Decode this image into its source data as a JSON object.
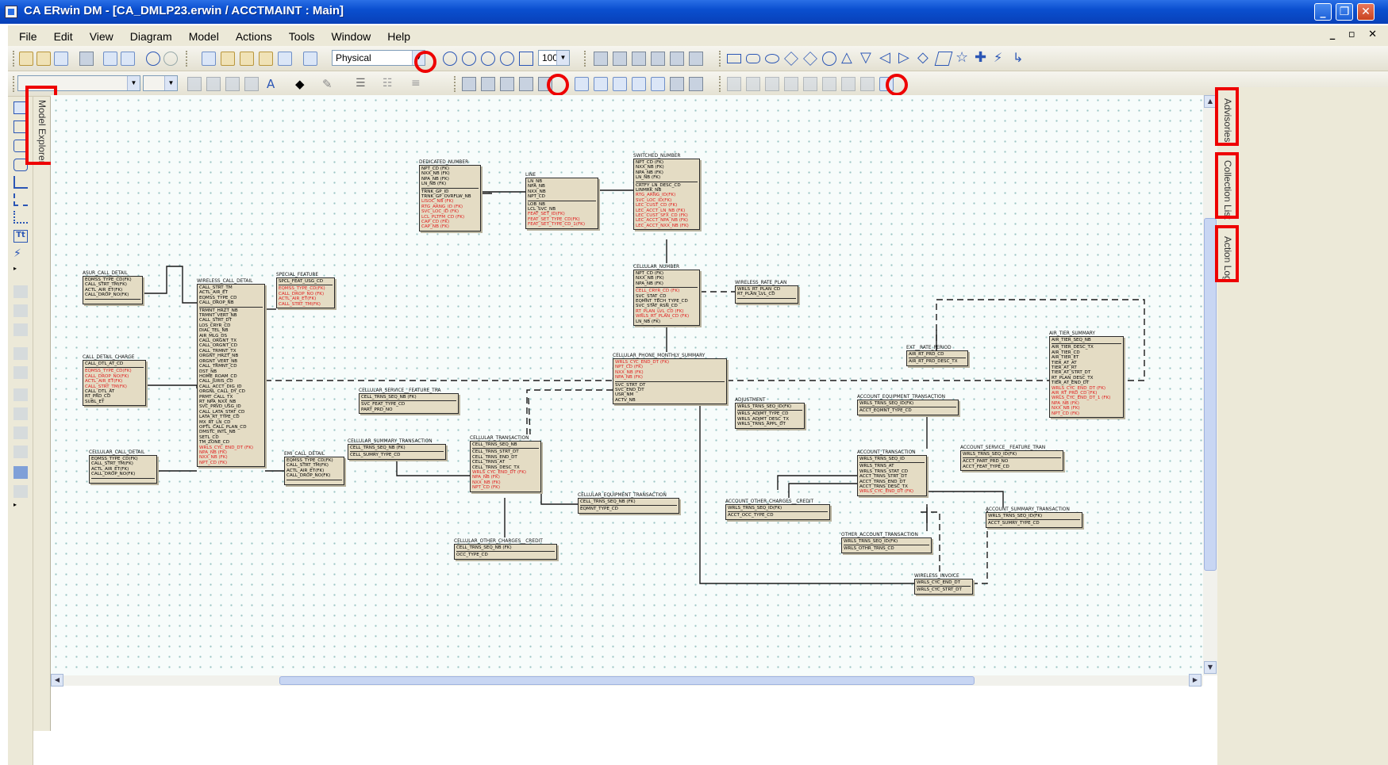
{
  "window": {
    "title": "CA ERwin DM - [CA_DMLP23.erwin / ACCTMAINT : Main]"
  },
  "menu": [
    "File",
    "Edit",
    "View",
    "Diagram",
    "Model",
    "Actions",
    "Tools",
    "Window",
    "Help"
  ],
  "mdi_controls": "_ ▫ ✕",
  "toolbar": {
    "view_mode": "Physical",
    "zoom": "100"
  },
  "panels": {
    "model_explorer": "Model Explorer",
    "advisories": "Advisories",
    "collection_list": "Collection List",
    "action_log": "Action Log"
  },
  "colors": {
    "attribute_fk": "#e02020",
    "entity_fill": "#e4dcc4",
    "highlight": "#ee0000"
  },
  "entities": [
    {
      "id": "dedicated",
      "name": "DEDICATED_NUMBER",
      "keys": [
        "NPT_CD (FK)",
        "NXX_NB (FK)",
        "NPA_NB (FK)",
        "LN_NB (FK)"
      ],
      "attrs": [
        [
          "TRNK_GP_ID",
          0
        ],
        [
          "TRNK_GP_OVRFLW_NB",
          0
        ],
        [
          "LISOC_NB (FK)",
          1
        ],
        [
          "RTG_ARNG_ID (FK)",
          1
        ],
        [
          "SVC_LOC_ID (FK)",
          1
        ],
        [
          "LCL_PLTFM_CD (FK)",
          1
        ],
        [
          "CAP_CD (FK)",
          1
        ],
        [
          "CAP_NB (FK)",
          1
        ]
      ]
    },
    {
      "id": "line",
      "name": "LINE",
      "keys": [
        "LN_NB",
        "NPA_NB",
        "NXX_NB",
        "NPT_CD"
      ],
      "attrs": [
        [
          "LOB_NB",
          0
        ],
        [
          "LCL_SVC_NB",
          0
        ],
        [
          "FEAT_SET_ID(FK)",
          1
        ],
        [
          "FEAT_SET_TYPE_CD(FK)",
          1
        ],
        [
          "FEAT_SET_TYPE_CD_1(FK)",
          1
        ]
      ]
    },
    {
      "id": "switched",
      "name": "SWITCHED_NUMBER",
      "keys": [
        "NPT_CD (FK)",
        "NXX_NB (FK)",
        "NPA_NB (FK)",
        "LN_NB (FK)"
      ],
      "attrs": [
        [
          "CRTFY_LN_DESC_CD",
          0
        ],
        [
          "LINMRK_NB",
          0
        ],
        [
          "RTG_ARNG_ID(FK)",
          1
        ],
        [
          "SVC_LOC_ID(FK)",
          1
        ],
        [
          "LEC_CUST_CD (FK)",
          1
        ],
        [
          "LEC_ACCT_LN_NB (FK)",
          1
        ],
        [
          "LEC_CUST_SFX_CD (FK)",
          1
        ],
        [
          "LEC_ACCT_NPA_NB (FK)",
          1
        ],
        [
          "LEC_ACCT_NXX_NB (FK)",
          1
        ]
      ]
    },
    {
      "id": "cellnum",
      "name": "CELLULAR_NUMBER",
      "keys": [
        "NPT_CD (FK)",
        "NXX_NB (FK)",
        "NPA_NB (FK)"
      ],
      "attrs": [
        [
          "CELL_CRYR_CD (FK)",
          1
        ],
        [
          "SVC_STAT_CD",
          0
        ],
        [
          "EQMNT_TECH_TYPE_CD",
          0
        ],
        [
          "SVC_STAT_RSN_CD",
          0
        ],
        [
          "RT_PLAN_LVL_CD (FK)",
          1
        ],
        [
          "WRLS_RT_PLAN_CD (FK)",
          1
        ],
        [
          "LN_NB (FK)",
          0
        ]
      ]
    },
    {
      "id": "wrate",
      "name": "WIRELESS_RATE_PLAN",
      "keys": [
        "WRLS_RT_PLAN_CD",
        "RT_PLAN_LVL_CD"
      ],
      "attrs": []
    },
    {
      "id": "asur",
      "name": "ASUR_CALL_DETAIL",
      "keys": [
        "EQMSS_TYPE_CD(FK)",
        "CALL_STRT_TM(FK)",
        "ACTL_AIR_ET(FK)",
        "CALL_DROP_NO(FK)"
      ],
      "attrs": []
    },
    {
      "id": "wcall",
      "name": "WIRELESS_CALL_DETAIL",
      "keys": [
        "CALL_STRT_TM",
        "ACTL_AIR_ET",
        "EQMSS_TYPE_CD",
        "CALL_DROP_NB"
      ],
      "attrs": [
        [
          "TRMNT_HRZT_NB",
          0
        ],
        [
          "TRMNT_VERT_NB",
          0
        ],
        [
          "CALL_STRT_DT",
          0
        ],
        [
          "LOS_CRYR_CD",
          0
        ],
        [
          "DIAL_TEL_NB",
          0
        ],
        [
          "AIR_MLG_DS",
          0
        ],
        [
          "CALL_ORGNT_TX",
          0
        ],
        [
          "CALL_ORGNT_CD",
          0
        ],
        [
          "CALL_TRMNT_TX",
          0
        ],
        [
          "ORGNT_HRZT_NB",
          0
        ],
        [
          "ORGNT_VERT_NB",
          0
        ],
        [
          "CALL_TRMNT_CD",
          0
        ],
        [
          "DST_NB",
          0
        ],
        [
          "HOME_ROAM_CD",
          0
        ],
        [
          "CALL_JURIS_CD",
          0
        ],
        [
          "CALL_ACCT_DIG_ID",
          0
        ],
        [
          "ORGNL_CALL_DY_CD",
          0
        ],
        [
          "PRMT_CALL_TX",
          0
        ],
        [
          "RT_NPA_NXX_NB",
          0
        ],
        [
          "SVC_PRVD_USG_ID",
          0
        ],
        [
          "CALL_LATA_STAT_CD",
          0
        ],
        [
          "LATA_RT_TYPE_CD",
          0
        ],
        [
          "MX_RT_LN_CD",
          0
        ],
        [
          "OPTL_CALL_PLAN_CD",
          0
        ],
        [
          "DMSTC_INTL_NB",
          0
        ],
        [
          "SETL_CD",
          0
        ],
        [
          "TM_ZONE_CD",
          0
        ],
        [
          "WRLS_CYC_END_DT (FK)",
          1
        ],
        [
          "NPA_NB (FK)",
          1
        ],
        [
          "NXX_NB (FK)",
          1
        ],
        [
          "NPT_CD (FK)",
          1
        ]
      ]
    },
    {
      "id": "special",
      "name": "SPECIAL_FEATURE",
      "keys": [
        "SPCL_FEAT_USG_CD"
      ],
      "attrs": [
        [
          "EQMSS_TYPE_CD(FK)",
          1
        ],
        [
          "CALL_DROP_NO (FK)",
          1
        ],
        [
          "ACTL_AIR_ET(FK)",
          1
        ],
        [
          "CALL_STRT_TM(FK)",
          1
        ]
      ]
    },
    {
      "id": "cdcharge",
      "name": "CALL_DETAIL_CHARGE",
      "keys": [
        "CALL_DTL_AT_CD"
      ],
      "attrs": [
        [
          "EQMSS_TYPE_CD(FK)",
          1
        ],
        [
          "CALL_DROP_NO(FK)",
          1
        ],
        [
          "ACTL_AIR_ET(FK)",
          1
        ],
        [
          "CALL_STRT_TM(FK)",
          1
        ],
        [
          "CALL_DTL_AT",
          0
        ],
        [
          "RT_PRD_CD",
          0
        ],
        [
          "SUBL_ET",
          0
        ]
      ]
    },
    {
      "id": "cellcall",
      "name": "CELLULAR_CALL_DETAIL",
      "keys": [
        "EQMSS_TYPE_CD(FK)",
        "CALL_STRT_TM(FK)",
        "ACTL_AIR_ET(FK)",
        "CALL_DROP_NO(FK)"
      ],
      "attrs": []
    },
    {
      "id": "emcall",
      "name": "EMI_CALL_DETAIL",
      "keys": [
        "EQMSS_TYPE_CD(FK)",
        "CALL_STRT_TM(FK)",
        "ACTL_AIR_ET(FK)",
        "CALL_DROP_NO(FK)"
      ],
      "attrs": []
    },
    {
      "id": "monthly",
      "name": "CELLULAR_PHONE_MONTHLY_SUMMARY",
      "keys": [
        "WRLS_CYC_END_DT (FK)",
        "NPT_CD (FK)",
        "NXX_NB (FK)",
        "NPA_NB (FK)"
      ],
      "attrs": [
        [
          "SVC_STRT_DT",
          0
        ],
        [
          "SVC_END_DT",
          0
        ],
        [
          "USR_NM",
          0
        ],
        [
          "ACTV_NB",
          0
        ]
      ]
    },
    {
      "id": "cellsvc",
      "name": "CELLULAR_SERVICE__FEATURE_TRA",
      "keys": [
        "CELL_TRNS_SEQ_NB (FK)"
      ],
      "attrs": [
        [
          "SVC_FEAT_TYPE_CD",
          0
        ],
        [
          "PART_PRD_NO",
          0
        ]
      ]
    },
    {
      "id": "cellsum",
      "name": "CELLULAR_SUMMARY_TRANSACTION",
      "keys": [
        "CELL_TRNS_SEQ_NB (FK)"
      ],
      "attrs": [
        [
          "CELL_SUMRY_TYPE_CD",
          0
        ]
      ]
    },
    {
      "id": "celltrans",
      "name": "CELLULAR_TRANSACTION",
      "keys": [
        "CELL_TRNS_SEQ_NB"
      ],
      "attrs": [
        [
          "CELL_TRNS_STRT_DT",
          0
        ],
        [
          "CELL_TRNS_END_DT",
          0
        ],
        [
          "CELL_TRNS_AT",
          0
        ],
        [
          "CELL_TRNS_DESC_TX",
          0
        ],
        [
          "WRLS_CYC_END_DT (FK)",
          1
        ],
        [
          "NPA_NB (FK)",
          1
        ],
        [
          "NXX_NB (FK)",
          1
        ],
        [
          "NPT_CD (FK)",
          1
        ]
      ]
    },
    {
      "id": "celleq",
      "name": "CELLULAR_EQUIPMENT_TRANSACTION",
      "keys": [
        "CELL_TRNS_SEQ_NB (FK)"
      ],
      "attrs": [
        [
          "EQMNT_TYPE_CD",
          0
        ]
      ]
    },
    {
      "id": "cellother",
      "name": "CELLULAR_OTHER_CHARGES__CREDIT",
      "keys": [
        "CELL_TRNS_SEQ_NB (FK)"
      ],
      "attrs": [
        [
          "OCC_TYPE_CD",
          0
        ]
      ]
    },
    {
      "id": "adjust",
      "name": "ADJUSTMENT",
      "keys": [
        "WRLS_TRNS_SEQ_ID(FK)"
      ],
      "attrs": [
        [
          "WRLS_ADJMT_TYPE_CD",
          0
        ],
        [
          "WRLS_ADJMT_DESC_TX",
          0
        ],
        [
          "WRLS_TRNS_APPL_DT",
          0
        ]
      ]
    },
    {
      "id": "accteq",
      "name": "ACCOUNT_EQUIPMENT_TRANSACTION",
      "keys": [
        "WRLS_TRNS_SEQ_ID(FK)"
      ],
      "attrs": [
        [
          "ACCT_EQMNT_TYPE_CD",
          0
        ]
      ]
    },
    {
      "id": "ext",
      "name": "EXT__RATE_PERIOD",
      "keys": [
        "AIR_RT_PRD_CD"
      ],
      "attrs": [
        [
          "AIR_RT_PRD_DESC_TX",
          0
        ]
      ]
    },
    {
      "id": "airtier",
      "name": "AIR_TIER_SUMMARY",
      "keys": [
        "AIR_TIER_SEQ_NB"
      ],
      "attrs": [
        [
          "AIR_TIER_DESC_TX",
          0
        ],
        [
          "AIR_TIER_CD",
          0
        ],
        [
          "AIR_TIER_ET",
          0
        ],
        [
          "TIER_AT_AT",
          0
        ],
        [
          "TIER_AT_RT",
          0
        ],
        [
          "TIER_AT_STRT_DT",
          0
        ],
        [
          "RT_PLAN_DESC_TX",
          0
        ],
        [
          "TIER_AT_END_DT",
          0
        ],
        [
          "WRLS_CYC_END_DT (FK)",
          1
        ],
        [
          "AIR_RT_PRD_CD (FK)",
          1
        ],
        [
          "WRLS_CYC_END_DT_1 (FK)",
          1
        ],
        [
          "NPA_NB (FK)",
          1
        ],
        [
          "NXX_NB (FK)",
          1
        ],
        [
          "NPT_CD (FK)",
          1
        ]
      ]
    },
    {
      "id": "acctsvc",
      "name": "ACCOUNT_SERVICE__FEATURE_TRAN",
      "keys": [
        "WRLS_TRNS_SEQ_ID(FK)"
      ],
      "attrs": [
        [
          "ACCT_PART_PRD_NO",
          0
        ],
        [
          "ACCT_FEAT_TYPE_CD",
          0
        ]
      ]
    },
    {
      "id": "accttrans",
      "name": "ACCOUNT_TRANSACTION",
      "keys": [
        "WRLS_TRNS_SEQ_ID"
      ],
      "attrs": [
        [
          "WRLS_TRNS_AT",
          0
        ],
        [
          "WRLS_TRNS_STAT_CD",
          0
        ],
        [
          "ACCT_TRNS_STRT_DT",
          0
        ],
        [
          "ACCT_TRNS_END_DT",
          0
        ],
        [
          "ACCT_TRNS_DESC_TX",
          0
        ],
        [
          "WRLS_CYC_END_DT (FK)",
          1
        ]
      ]
    },
    {
      "id": "acctother",
      "name": "ACCOUNT_OTHER_CHARGES__CREDIT",
      "keys": [
        "WRLS_TRNS_SEQ_ID(FK)"
      ],
      "attrs": [
        [
          "ACCT_OCC_TYPE_CD",
          0
        ]
      ]
    },
    {
      "id": "acctsum",
      "name": "ACCOUNT_SUMMARY_TRANSACTION",
      "keys": [
        "WRLS_TRNS_SEQ_ID(FK)"
      ],
      "attrs": [
        [
          "ACCT_SUMRY_TYPE_CD",
          0
        ]
      ]
    },
    {
      "id": "otheracct",
      "name": "OTHER_ACCOUNT_TRANSACTION",
      "keys": [
        "WRLS_TRNS_SEQ_ID(FK)"
      ],
      "attrs": [
        [
          "WRLS_OTHR_TRNS_CD",
          0
        ]
      ]
    },
    {
      "id": "invoice",
      "name": "WIRELESS_INVOICE",
      "keys": [
        "WRLS_CYC_END_DT"
      ],
      "attrs": [
        [
          "WRLS_CYC_STRT_DT",
          0
        ]
      ]
    }
  ]
}
